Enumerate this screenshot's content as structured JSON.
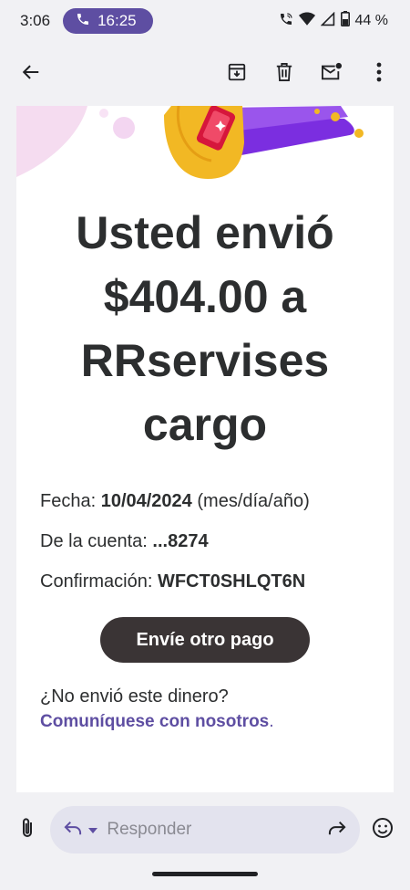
{
  "status_bar": {
    "time": "3:06",
    "call_time": "16:25",
    "battery": "44 %",
    "icons": [
      "phone-icon",
      "wifi-call-icon",
      "wifi-icon",
      "signal-icon",
      "battery-icon"
    ]
  },
  "app_bar": {
    "icons": [
      "back-arrow-icon",
      "archive-icon",
      "delete-icon",
      "mark-unread-icon",
      "more-vert-icon"
    ]
  },
  "email": {
    "headline": "Usted envió\n$404.00 a\nRRservises\ncargo",
    "date_label": "Fecha: ",
    "date_value": "10/04/2024",
    "date_suffix": " (mes/día/año)",
    "account_label": "De la cuenta: ",
    "account_value": "...8274",
    "confirmation_label": "Confirmación: ",
    "confirmation_value": "WFCT0SHLQT6N",
    "cta_label": "Envíe otro pago",
    "question": "¿No envió este dinero?",
    "contact_link": "Comuníquese con nosotros",
    "contact_dot": "."
  },
  "reply_bar": {
    "placeholder": "Responder",
    "icons": [
      "attach-icon",
      "reply-icon",
      "dropdown-icon",
      "forward-icon",
      "emoji-icon"
    ]
  },
  "colors": {
    "accent": "#5e4ea2",
    "cta": "#3a3435",
    "text": "#2c2e2f",
    "background": "#f1f1f4",
    "hero_gold": "#f2b824",
    "hero_purple": "#7b2ee0"
  }
}
